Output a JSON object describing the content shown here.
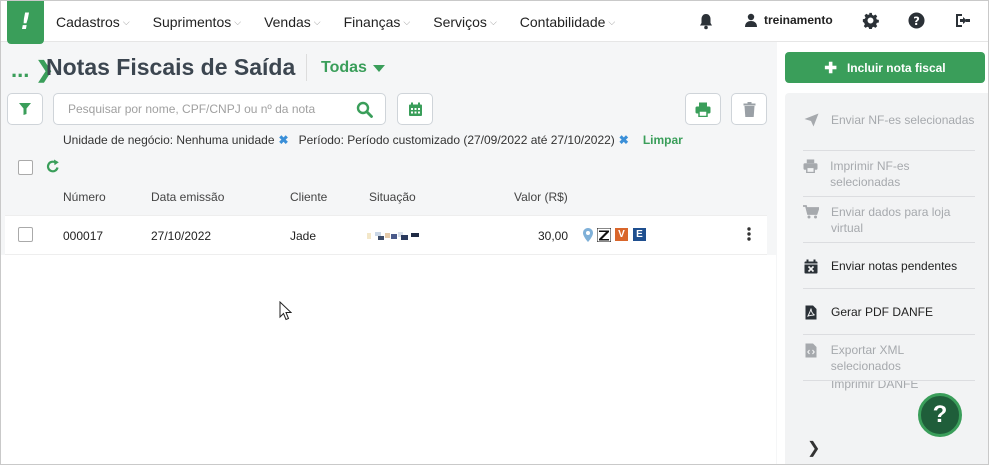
{
  "nav": {
    "logo": "!",
    "menu": [
      {
        "label": "Cadastros"
      },
      {
        "label": "Suprimentos"
      },
      {
        "label": "Vendas"
      },
      {
        "label": "Finanças"
      },
      {
        "label": "Serviços"
      },
      {
        "label": "Contabilidade"
      }
    ],
    "user": "treinamento"
  },
  "header": {
    "breadcrumb": "...",
    "title": "Notas Fiscais de Saída",
    "filter": "Todas"
  },
  "search": {
    "placeholder": "Pesquisar por nome, CPF/CNPJ ou nº da nota"
  },
  "filters": {
    "chip1": "Unidade de negócio: Nenhuma unidade",
    "chip2": "Período: Período customizado (27/09/2022 até 27/10/2022)",
    "clear": "Limpar"
  },
  "table": {
    "headers": [
      "Número",
      "Data emissão",
      "Cliente",
      "Situação",
      "Valor (R$)"
    ],
    "rows": [
      {
        "numero": "000017",
        "data": "27/10/2022",
        "cliente": "Jade",
        "valor": "30,00",
        "badges": [
          "V",
          "E"
        ]
      }
    ]
  },
  "side": {
    "include_label": "Incluir nota fiscal",
    "actions": [
      {
        "label": "Enviar NF-es selecionadas",
        "enabled": false,
        "icon": "send-icon"
      },
      {
        "label": "Imprimir NF-es selecionadas",
        "enabled": false,
        "icon": "print-icon"
      },
      {
        "label": "Enviar dados para loja virtual",
        "enabled": false,
        "icon": "cart-icon"
      },
      {
        "label": "Enviar notas pendentes",
        "enabled": true,
        "icon": "calendar-x-icon"
      },
      {
        "label": "Gerar PDF DANFE",
        "enabled": true,
        "icon": "pdf-icon"
      },
      {
        "label": "Exportar XML selecionados",
        "enabled": false,
        "icon": "code-file-icon"
      },
      {
        "label": "Imprimir DANFE",
        "enabled": false,
        "icon": "print-icon"
      }
    ],
    "help": "?"
  },
  "colors": {
    "brand": "#3a9e5a",
    "title": "#3c4650",
    "link": "#3a8fd8"
  }
}
